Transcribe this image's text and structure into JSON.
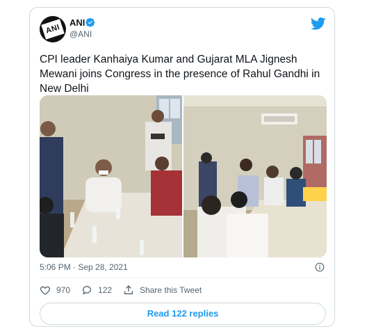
{
  "author": {
    "name": "ANI",
    "handle": "@ANI",
    "avatar_text": "ANI",
    "verified": true
  },
  "tweet": {
    "text": "CPI leader Kanhaiya Kumar and Gujarat MLA Jignesh Mewani joins Congress in the presence of Rahul Gandhi in New Delhi",
    "timestamp": "5:06 PM · Sep 28, 2021"
  },
  "actions": {
    "likes": "970",
    "replies": "122",
    "share_label": "Share this Tweet"
  },
  "read_more": {
    "label": "Read 122 replies"
  },
  "icons": {
    "verified": "verified-badge-icon",
    "brand": "twitter-bird-icon",
    "info": "info-icon",
    "like": "heart-icon",
    "reply": "reply-bubble-icon",
    "share": "share-upload-icon"
  },
  "colors": {
    "brand_blue": "#1d9bf0",
    "text_primary": "#0f1419",
    "text_secondary": "#536471",
    "border": "#cfd9de"
  }
}
